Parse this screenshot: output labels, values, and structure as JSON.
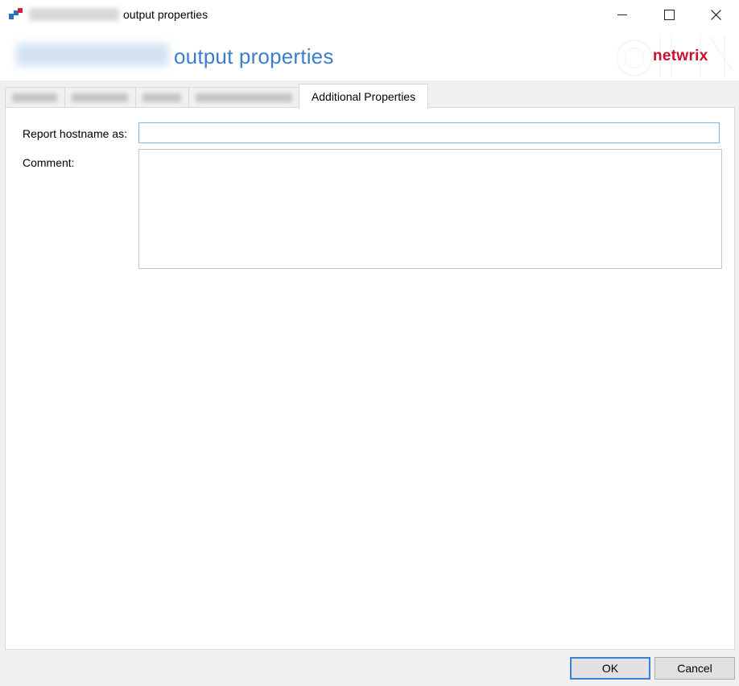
{
  "window": {
    "title_suffix": "output properties",
    "icon": "app-icon"
  },
  "header": {
    "title_suffix": "output properties",
    "logo_text": "netwrix"
  },
  "tabs": [
    {
      "label": "",
      "active": false
    },
    {
      "label": "",
      "active": false
    },
    {
      "label": "",
      "active": false
    },
    {
      "label": "",
      "active": false
    },
    {
      "label": "Additional Properties",
      "active": true
    }
  ],
  "form": {
    "hostname_label": "Report hostname as:",
    "hostname_value": "",
    "comment_label": "Comment:",
    "comment_value": ""
  },
  "buttons": {
    "ok_label": "OK",
    "cancel_label": "Cancel"
  },
  "colors": {
    "header_title": "#3d7ecb",
    "logo": "#c8102e",
    "focus_border": "#7eb4ea"
  }
}
